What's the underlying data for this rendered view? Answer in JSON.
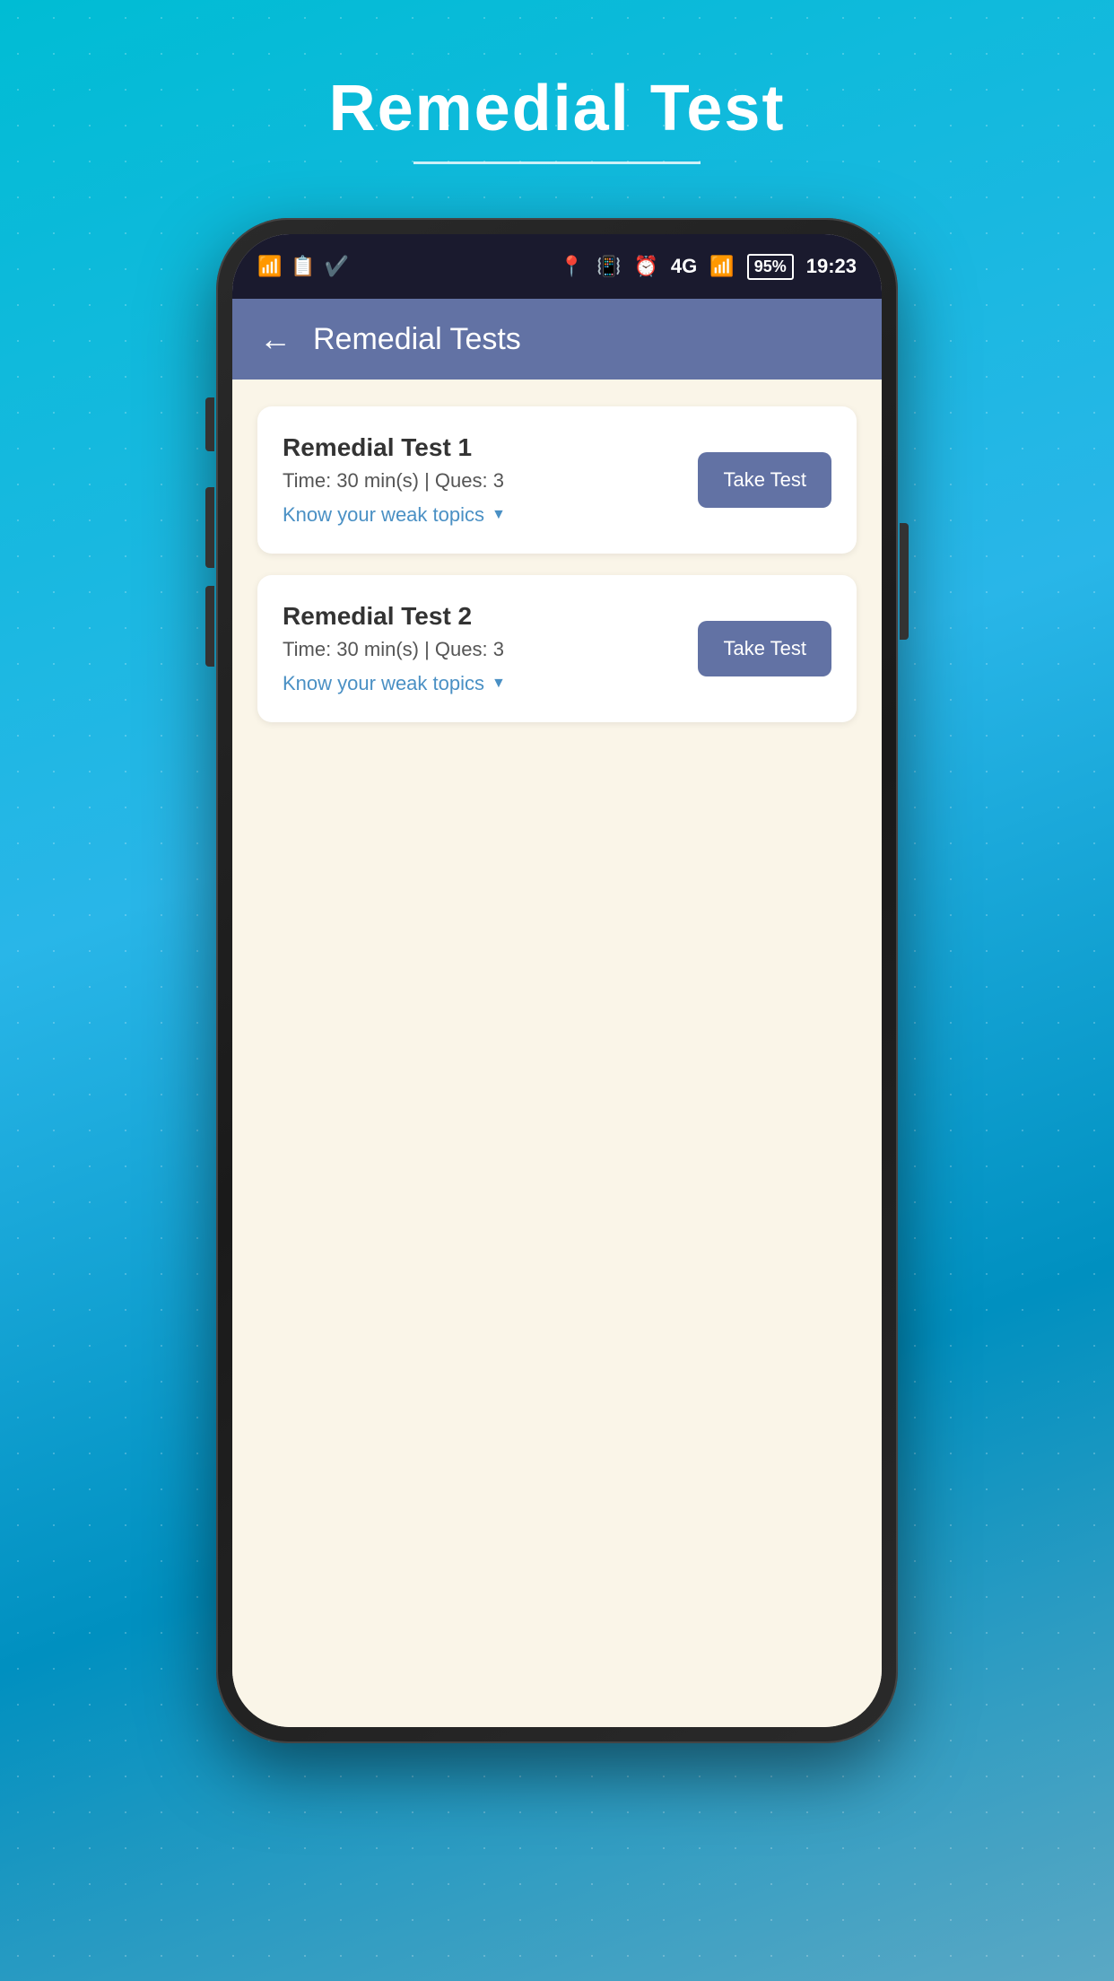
{
  "page": {
    "title": "Remedial Test",
    "title_underline": true
  },
  "status_bar": {
    "time": "19:23",
    "battery_percent": "95%",
    "signal": "4G",
    "icons_left": [
      "wifi-icon",
      "message-icon",
      "verified-icon"
    ]
  },
  "app_header": {
    "back_label": "←",
    "title": "Remedial Tests"
  },
  "tests": [
    {
      "id": 1,
      "title": "Remedial Test 1",
      "meta": "Time: 30 min(s) | Ques: 3",
      "weak_topics_label": "Know your weak topics",
      "button_label": "Take Test"
    },
    {
      "id": 2,
      "title": "Remedial Test 2",
      "meta": "Time: 30 min(s) | Ques: 3",
      "weak_topics_label": "Know your weak topics",
      "button_label": "Take Test"
    }
  ],
  "colors": {
    "header_bg": "#6272a4",
    "content_bg": "#faf5e8",
    "card_bg": "#ffffff",
    "button_bg": "#6272a4",
    "link_color": "#4a90c4",
    "background_top": "#00bcd4",
    "background_bottom": "#0090c0"
  }
}
